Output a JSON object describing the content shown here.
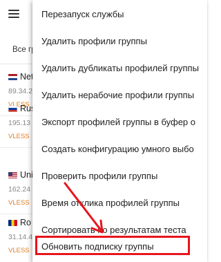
{
  "app_bar": {
    "menu_icon": "hamburger-menu-icon"
  },
  "group_filter": {
    "label": "Все гр"
  },
  "servers": [
    {
      "name": "Net",
      "flag": "netherlands-flag-icon",
      "ip": "89.34.2",
      "protocol": "VLESS"
    },
    {
      "name": "Rus",
      "flag": "russia-flag-icon",
      "ip": "195.13",
      "protocol": "VLESS"
    },
    {
      "name": "Uni",
      "flag": "usa-flag-icon",
      "ip": "162.24",
      "protocol": "VLESS"
    },
    {
      "name": "Ro",
      "flag": "romania-flag-icon",
      "ip": "31.14.4",
      "protocol": "VLESS"
    }
  ],
  "menu": {
    "items": [
      {
        "label": "Перезапуск службы"
      },
      {
        "label": "Удалить профили группы"
      },
      {
        "label": "Удалить дубликаты профилей группы"
      },
      {
        "label": "Удалить нерабочие профили группы"
      },
      {
        "label": "Экспорт профилей группы в буфер о"
      },
      {
        "label": "Создать конфигурацию умного выбо"
      },
      {
        "label": "Проверить профили группы"
      },
      {
        "label": "Время отклика профилей группы"
      },
      {
        "label": "Сортировать по результатам теста"
      },
      {
        "label": "Обновить подписку группы"
      }
    ]
  },
  "colors": {
    "highlight": "#e8141c",
    "protocol_text": "#e07c1c",
    "menu_background": "#ffffff"
  }
}
